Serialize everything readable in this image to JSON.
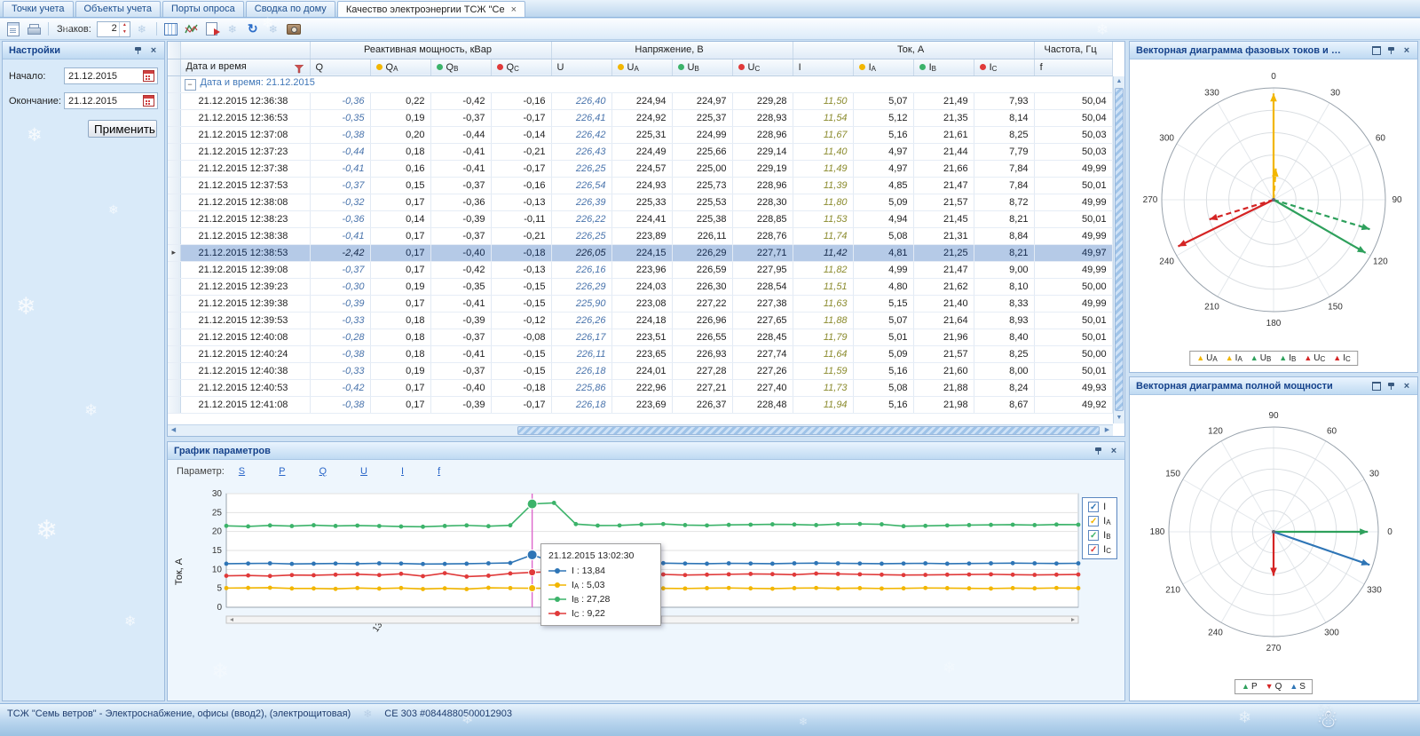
{
  "icons": {
    "close": "×",
    "up": "▲",
    "down": "▼",
    "left": "◀",
    "right": "▶",
    "row_marker": "▸",
    "collapse": "−",
    "refresh": "↻",
    "snowflake": "❄",
    "snowman": "☃",
    "check": "✓"
  },
  "tabs": [
    {
      "label": "Точки учета"
    },
    {
      "label": "Объекты учета"
    },
    {
      "label": "Порты опроса"
    },
    {
      "label": "Сводка по дому"
    },
    {
      "label": "Качество электроэнергии ТСЖ \"Се",
      "active": true
    }
  ],
  "toolbar": {
    "znakov_label": "Знаков:",
    "znakov_value": "2"
  },
  "settings": {
    "title": "Настройки",
    "start_label": "Начало:",
    "start_value": "21.12.2015",
    "end_label": "Окончание:",
    "end_value": "21.12.2015",
    "apply_label": "Применить"
  },
  "grid": {
    "group_headers": [
      {
        "label": "Реактивная мощность, кВар",
        "span": 4
      },
      {
        "label": "Напряжение, В",
        "span": 4
      },
      {
        "label": "Ток, А",
        "span": 4
      },
      {
        "label": "Частота, Гц",
        "span": 1
      }
    ],
    "datetime_header": "Дата и время",
    "columns": [
      {
        "label": "Q",
        "sub": "",
        "dot": ""
      },
      {
        "label": "Q",
        "sub": "А",
        "dot": "#f2b600"
      },
      {
        "label": "Q",
        "sub": "В",
        "dot": "#3cb36a"
      },
      {
        "label": "Q",
        "sub": "С",
        "dot": "#e03a3a"
      },
      {
        "label": "U",
        "sub": "",
        "dot": ""
      },
      {
        "label": "U",
        "sub": "А",
        "dot": "#f2b600"
      },
      {
        "label": "U",
        "sub": "В",
        "dot": "#3cb36a"
      },
      {
        "label": "U",
        "sub": "С",
        "dot": "#e03a3a"
      },
      {
        "label": "I",
        "sub": "",
        "dot": ""
      },
      {
        "label": "I",
        "sub": "А",
        "dot": "#f2b600"
      },
      {
        "label": "I",
        "sub": "В",
        "dot": "#3cb36a"
      },
      {
        "label": "I",
        "sub": "С",
        "dot": "#e03a3a"
      },
      {
        "label": "f",
        "sub": "",
        "dot": ""
      }
    ],
    "group_row_label": "Дата и время: 21.12.2015",
    "selected_index": 9,
    "rows": [
      [
        "21.12.2015 12:36:38",
        "-0,36",
        "0,22",
        "-0,42",
        "-0,16",
        "226,40",
        "224,94",
        "224,97",
        "229,28",
        "11,50",
        "5,07",
        "21,49",
        "7,93",
        "50,04"
      ],
      [
        "21.12.2015 12:36:53",
        "-0,35",
        "0,19",
        "-0,37",
        "-0,17",
        "226,41",
        "224,92",
        "225,37",
        "228,93",
        "11,54",
        "5,12",
        "21,35",
        "8,14",
        "50,04"
      ],
      [
        "21.12.2015 12:37:08",
        "-0,38",
        "0,20",
        "-0,44",
        "-0,14",
        "226,42",
        "225,31",
        "224,99",
        "228,96",
        "11,67",
        "5,16",
        "21,61",
        "8,25",
        "50,03"
      ],
      [
        "21.12.2015 12:37:23",
        "-0,44",
        "0,18",
        "-0,41",
        "-0,21",
        "226,43",
        "224,49",
        "225,66",
        "229,14",
        "11,40",
        "4,97",
        "21,44",
        "7,79",
        "50,03"
      ],
      [
        "21.12.2015 12:37:38",
        "-0,41",
        "0,16",
        "-0,41",
        "-0,17",
        "226,25",
        "224,57",
        "225,00",
        "229,19",
        "11,49",
        "4,97",
        "21,66",
        "7,84",
        "49,99"
      ],
      [
        "21.12.2015 12:37:53",
        "-0,37",
        "0,15",
        "-0,37",
        "-0,16",
        "226,54",
        "224,93",
        "225,73",
        "228,96",
        "11,39",
        "4,85",
        "21,47",
        "7,84",
        "50,01"
      ],
      [
        "21.12.2015 12:38:08",
        "-0,32",
        "0,17",
        "-0,36",
        "-0,13",
        "226,39",
        "225,33",
        "225,53",
        "228,30",
        "11,80",
        "5,09",
        "21,57",
        "8,72",
        "49,99"
      ],
      [
        "21.12.2015 12:38:23",
        "-0,36",
        "0,14",
        "-0,39",
        "-0,11",
        "226,22",
        "224,41",
        "225,38",
        "228,85",
        "11,53",
        "4,94",
        "21,45",
        "8,21",
        "50,01"
      ],
      [
        "21.12.2015 12:38:38",
        "-0,41",
        "0,17",
        "-0,37",
        "-0,21",
        "226,25",
        "223,89",
        "226,11",
        "228,76",
        "11,74",
        "5,08",
        "21,31",
        "8,84",
        "49,99"
      ],
      [
        "21.12.2015 12:38:53",
        "-2,42",
        "0,17",
        "-0,40",
        "-0,18",
        "226,05",
        "224,15",
        "226,29",
        "227,71",
        "11,42",
        "4,81",
        "21,25",
        "8,21",
        "49,97"
      ],
      [
        "21.12.2015 12:39:08",
        "-0,37",
        "0,17",
        "-0,42",
        "-0,13",
        "226,16",
        "223,96",
        "226,59",
        "227,95",
        "11,82",
        "4,99",
        "21,47",
        "9,00",
        "49,99"
      ],
      [
        "21.12.2015 12:39:23",
        "-0,30",
        "0,19",
        "-0,35",
        "-0,15",
        "226,29",
        "224,03",
        "226,30",
        "228,54",
        "11,51",
        "4,80",
        "21,62",
        "8,10",
        "50,00"
      ],
      [
        "21.12.2015 12:39:38",
        "-0,39",
        "0,17",
        "-0,41",
        "-0,15",
        "225,90",
        "223,08",
        "227,22",
        "227,38",
        "11,63",
        "5,15",
        "21,40",
        "8,33",
        "49,99"
      ],
      [
        "21.12.2015 12:39:53",
        "-0,33",
        "0,18",
        "-0,39",
        "-0,12",
        "226,26",
        "224,18",
        "226,96",
        "227,65",
        "11,88",
        "5,07",
        "21,64",
        "8,93",
        "50,01"
      ],
      [
        "21.12.2015 12:40:08",
        "-0,28",
        "0,18",
        "-0,37",
        "-0,08",
        "226,17",
        "223,51",
        "226,55",
        "228,45",
        "11,79",
        "5,01",
        "21,96",
        "8,40",
        "50,01"
      ],
      [
        "21.12.2015 12:40:24",
        "-0,38",
        "0,18",
        "-0,41",
        "-0,15",
        "226,11",
        "223,65",
        "226,93",
        "227,74",
        "11,64",
        "5,09",
        "21,57",
        "8,25",
        "50,00"
      ],
      [
        "21.12.2015 12:40:38",
        "-0,33",
        "0,19",
        "-0,37",
        "-0,15",
        "226,18",
        "224,01",
        "227,28",
        "227,26",
        "11,59",
        "5,16",
        "21,60",
        "8,00",
        "50,01"
      ],
      [
        "21.12.2015 12:40:53",
        "-0,42",
        "0,17",
        "-0,40",
        "-0,18",
        "225,86",
        "222,96",
        "227,21",
        "227,40",
        "11,73",
        "5,08",
        "21,88",
        "8,24",
        "49,93"
      ],
      [
        "21.12.2015 12:41:08",
        "-0,38",
        "0,17",
        "-0,39",
        "-0,17",
        "226,18",
        "223,69",
        "226,37",
        "228,48",
        "11,94",
        "5,16",
        "21,98",
        "8,67",
        "49,92"
      ]
    ]
  },
  "chart_panel": {
    "title": "График параметров",
    "param_label": "Параметр:",
    "param_links": [
      "S",
      "P",
      "Q",
      "U",
      "I",
      "f"
    ]
  },
  "chart_data": [
    {
      "type": "line",
      "ylabel": "Ток, А",
      "ylim": [
        0,
        30
      ],
      "yticks": [
        0,
        5,
        10,
        15,
        20,
        25,
        30
      ],
      "x_tick": {
        "label": "13",
        "pos": 0.18
      },
      "highlight_index": 14,
      "crosshair_color": "#dd66cc",
      "series": [
        {
          "name": "I",
          "sub": "",
          "color": "#2e75b6",
          "values": [
            11.5,
            11.55,
            11.6,
            11.45,
            11.5,
            11.55,
            11.5,
            11.6,
            11.55,
            11.42,
            11.45,
            11.5,
            11.6,
            11.7,
            13.84,
            11.9,
            11.6,
            11.55,
            11.5,
            11.6,
            11.65,
            11.55,
            11.5,
            11.6,
            11.55,
            11.5,
            11.6,
            11.65,
            11.6,
            11.55,
            11.5,
            11.55,
            11.6,
            11.5,
            11.55,
            11.6,
            11.65,
            11.6,
            11.55,
            11.6
          ]
        },
        {
          "name": "I",
          "sub": "А",
          "color": "#f2b600",
          "values": [
            5.07,
            5.12,
            5.16,
            4.97,
            4.97,
            4.85,
            5.09,
            4.94,
            5.08,
            4.81,
            4.99,
            4.8,
            5.15,
            5.07,
            5.03,
            5.01,
            5.09,
            5.16,
            5.08,
            5.16,
            5.0,
            4.95,
            5.05,
            5.1,
            5.0,
            4.9,
            5.05,
            5.1,
            5.0,
            5.05,
            4.95,
            5.0,
            5.1,
            5.05,
            5.0,
            4.95,
            5.05,
            5.0,
            5.1,
            5.05
          ]
        },
        {
          "name": "I",
          "sub": "В",
          "color": "#3cb36a",
          "values": [
            21.49,
            21.35,
            21.61,
            21.44,
            21.66,
            21.47,
            21.57,
            21.45,
            21.31,
            21.25,
            21.47,
            21.62,
            21.4,
            21.64,
            27.28,
            27.55,
            21.96,
            21.57,
            21.6,
            21.88,
            21.98,
            21.7,
            21.6,
            21.75,
            21.8,
            21.9,
            21.85,
            21.7,
            21.95,
            22.0,
            21.9,
            21.4,
            21.5,
            21.6,
            21.7,
            21.75,
            21.8,
            21.7,
            21.85,
            21.8
          ]
        },
        {
          "name": "I",
          "sub": "С",
          "color": "#e03a3a",
          "values": [
            8.3,
            8.4,
            8.25,
            8.5,
            8.45,
            8.6,
            8.72,
            8.5,
            8.84,
            8.21,
            9.0,
            8.1,
            8.33,
            8.93,
            9.22,
            9.4,
            8.4,
            8.25,
            8.0,
            8.24,
            8.67,
            8.5,
            8.6,
            8.7,
            8.8,
            8.75,
            8.6,
            8.9,
            8.8,
            8.7,
            8.6,
            8.5,
            8.55,
            8.6,
            8.65,
            8.7,
            8.6,
            8.55,
            8.6,
            8.65
          ]
        }
      ],
      "legend": [
        {
          "label": "I",
          "sub": "",
          "color": "#2e75b6"
        },
        {
          "label": "I",
          "sub": "А",
          "color": "#f2b600"
        },
        {
          "label": "I",
          "sub": "В",
          "color": "#3cb36a"
        },
        {
          "label": "I",
          "sub": "С",
          "color": "#e03a3a"
        }
      ],
      "tooltip": {
        "title": "21.12.2015 13:02:30",
        "items": [
          {
            "label": "I",
            "sub": "",
            "value": "13,84",
            "color": "#2e75b6"
          },
          {
            "label": "I",
            "sub": "А",
            "value": "5,03",
            "color": "#f2b600"
          },
          {
            "label": "I",
            "sub": "В",
            "value": "27,28",
            "color": "#3cb36a"
          },
          {
            "label": "I",
            "sub": "С",
            "value": "9,22",
            "color": "#e03a3a"
          }
        ]
      }
    },
    {
      "type": "polar-vectors",
      "title": "Векторная диаграмма фазовых токов и …",
      "orientation": "clockwise-top",
      "angle_labels": [
        0,
        30,
        60,
        90,
        120,
        150,
        180,
        210,
        240,
        270,
        300,
        330
      ],
      "vectors": [
        {
          "label": "U",
          "sub": "А",
          "angle": 0,
          "r": 0.95,
          "color": "#f2b600",
          "dashed": false
        },
        {
          "label": "I",
          "sub": "А",
          "angle": 4,
          "r": 0.28,
          "color": "#f2b600",
          "dashed": true
        },
        {
          "label": "U",
          "sub": "В",
          "angle": 120,
          "r": 0.95,
          "color": "#2ea05c",
          "dashed": false
        },
        {
          "label": "I",
          "sub": "В",
          "angle": 107,
          "r": 0.9,
          "color": "#2ea05c",
          "dashed": true
        },
        {
          "label": "U",
          "sub": "С",
          "angle": 244,
          "r": 0.95,
          "color": "#d42424",
          "dashed": false
        },
        {
          "label": "I",
          "sub": "С",
          "angle": 253,
          "r": 0.6,
          "color": "#d42424",
          "dashed": true
        }
      ],
      "legend": [
        {
          "label": "U",
          "sub": "А",
          "color": "#f2b600",
          "marker": "▲"
        },
        {
          "label": "I",
          "sub": "А",
          "color": "#f2b600",
          "marker": "▲"
        },
        {
          "label": "U",
          "sub": "В",
          "color": "#2ea05c",
          "marker": "▲"
        },
        {
          "label": "I",
          "sub": "В",
          "color": "#2ea05c",
          "marker": "▲"
        },
        {
          "label": "U",
          "sub": "С",
          "color": "#d42424",
          "marker": "▲"
        },
        {
          "label": "I",
          "sub": "С",
          "color": "#d42424",
          "marker": "▲"
        }
      ]
    },
    {
      "type": "polar-vectors",
      "title": "Векторная диаграмма полной мощности",
      "orientation": "counterclockwise-right",
      "angle_labels": [
        0,
        30,
        60,
        90,
        120,
        150,
        180,
        210,
        240,
        270,
        300,
        330
      ],
      "vectors": [
        {
          "label": "P",
          "sub": "",
          "angle": 0,
          "r": 0.9,
          "color": "#2ea05c",
          "dashed": false
        },
        {
          "label": "Q",
          "sub": "",
          "angle": 270,
          "r": 0.42,
          "color": "#d42424",
          "dashed": false
        },
        {
          "label": "S",
          "sub": "",
          "angle": 341,
          "r": 0.97,
          "color": "#2e75b6",
          "dashed": false
        }
      ],
      "legend": [
        {
          "label": "P",
          "sub": "",
          "color": "#2ea05c",
          "marker": "▲"
        },
        {
          "label": "Q",
          "sub": "",
          "color": "#d42424",
          "marker": "▼"
        },
        {
          "label": "S",
          "sub": "",
          "color": "#2e75b6",
          "marker": "▲"
        }
      ]
    }
  ],
  "status": {
    "text": "ТСЖ \"Семь ветров\" - Электроснабжение, офисы (ввод2), (электрощитовая)",
    "meter": "СЕ 303 #0844880500012903"
  }
}
